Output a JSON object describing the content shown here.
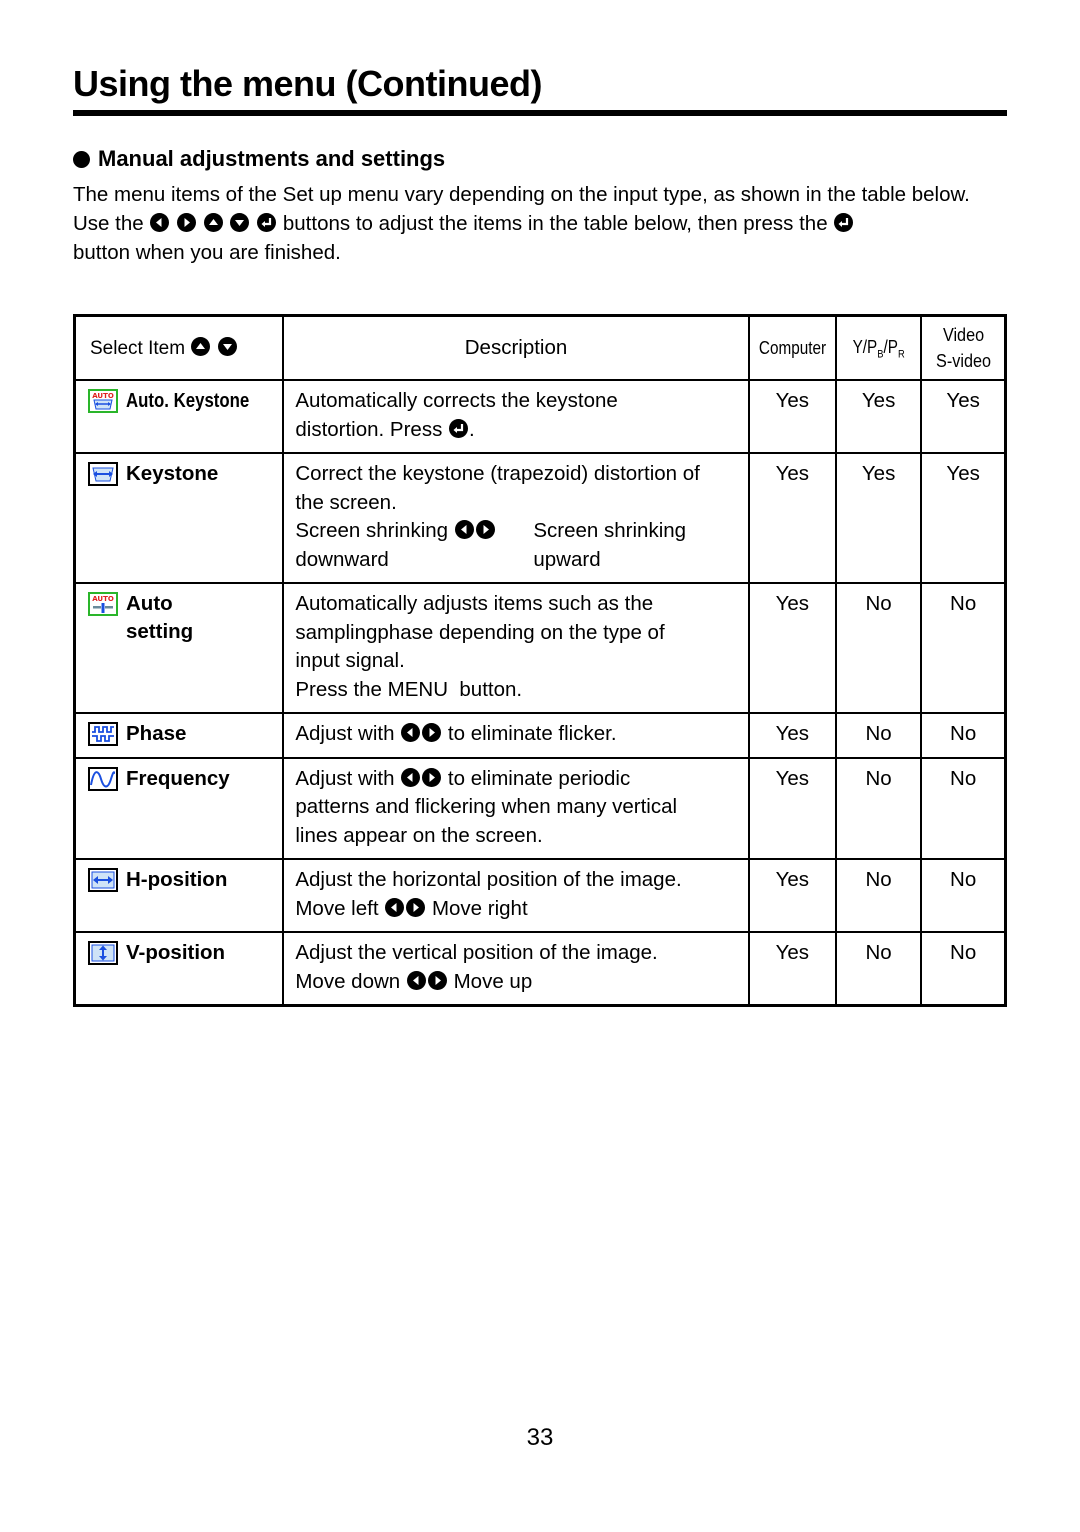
{
  "page": {
    "title": "Using the menu (Continued)",
    "section_heading": "Manual adjustments and settings",
    "intro": {
      "paragraph1": "The menu items of the Set up menu vary depending on the input type, as shown in the table below.",
      "paragraph2_before": "Use the",
      "paragraph2_after": "buttons to adjust the items in the table below, then press the",
      "paragraph2_end": "button when you are finished.",
      "buttons": [
        "left-button-icon",
        "right-button-icon",
        "up-button-icon",
        "down-button-icon",
        "enter-button-icon"
      ]
    },
    "page_number": "33"
  },
  "table": {
    "headers": {
      "select_item": "Select Item",
      "description": "Description",
      "computer": "Computer",
      "ypbpr": "Y/PB/PR",
      "ypbpr_parts": [
        "Y/P",
        "B",
        "/P",
        "R"
      ],
      "video_line1": "Video",
      "video_line2": "S-video"
    },
    "rows": [
      {
        "icon": "auto-keystone-icon",
        "label": "Auto. Keystone",
        "description": [
          "Automatically corrects the keystone",
          "distortion. Press"
        ],
        "computer": "Yes",
        "ypbpr": "Yes",
        "video": "Yes"
      },
      {
        "icon": "keystone-icon",
        "label": "Keystone",
        "description": [
          "Correct the keystone (trapezoid) distortion of",
          "the screen."
        ],
        "left_text": "Screen shrinking",
        "right_text": "Screen shrinking",
        "left_text2": "downward",
        "right_text2": "upward",
        "computer": "Yes",
        "ypbpr": "Yes",
        "video": "Yes"
      },
      {
        "icon": "auto-setting-icon",
        "label_line1": "Auto",
        "label_line2": "setting",
        "description": [
          "Automatically adjusts items such as the",
          "samplingphase depending on the type of",
          "input signal.",
          "Press the MENU  button."
        ],
        "computer": "Yes",
        "ypbpr": "No",
        "video": "No"
      },
      {
        "icon": "phase-icon",
        "label": "Phase",
        "description_before": "Adjust with",
        "description_after": "to eliminate flicker.",
        "computer": "Yes",
        "ypbpr": "No",
        "video": "No"
      },
      {
        "icon": "frequency-icon",
        "label": "Frequency",
        "description_before": "Adjust with",
        "description_after": "to eliminate periodic",
        "description_more": [
          "patterns and flickering when many vertical",
          "lines appear on the screen."
        ],
        "computer": "Yes",
        "ypbpr": "No",
        "video": "No"
      },
      {
        "icon": "h-position-icon",
        "label": "H-position",
        "description": "Adjust the horizontal position of the image.",
        "left_text": "Move left",
        "right_text": "Move right",
        "computer": "Yes",
        "ypbpr": "No",
        "video": "No"
      },
      {
        "icon": "v-position-icon",
        "label": "V-position",
        "description": "Adjust the vertical position of the image.",
        "left_text": "Move down",
        "right_text": "Move up",
        "computer": "Yes",
        "ypbpr": "No",
        "video": "No"
      }
    ]
  },
  "colors": {
    "text": "#000000",
    "icon_blue": "#1a4fe0",
    "icon_light_blue": "#cfe3f7",
    "auto_green": "#2ab52a",
    "auto_red": "#e02020"
  }
}
